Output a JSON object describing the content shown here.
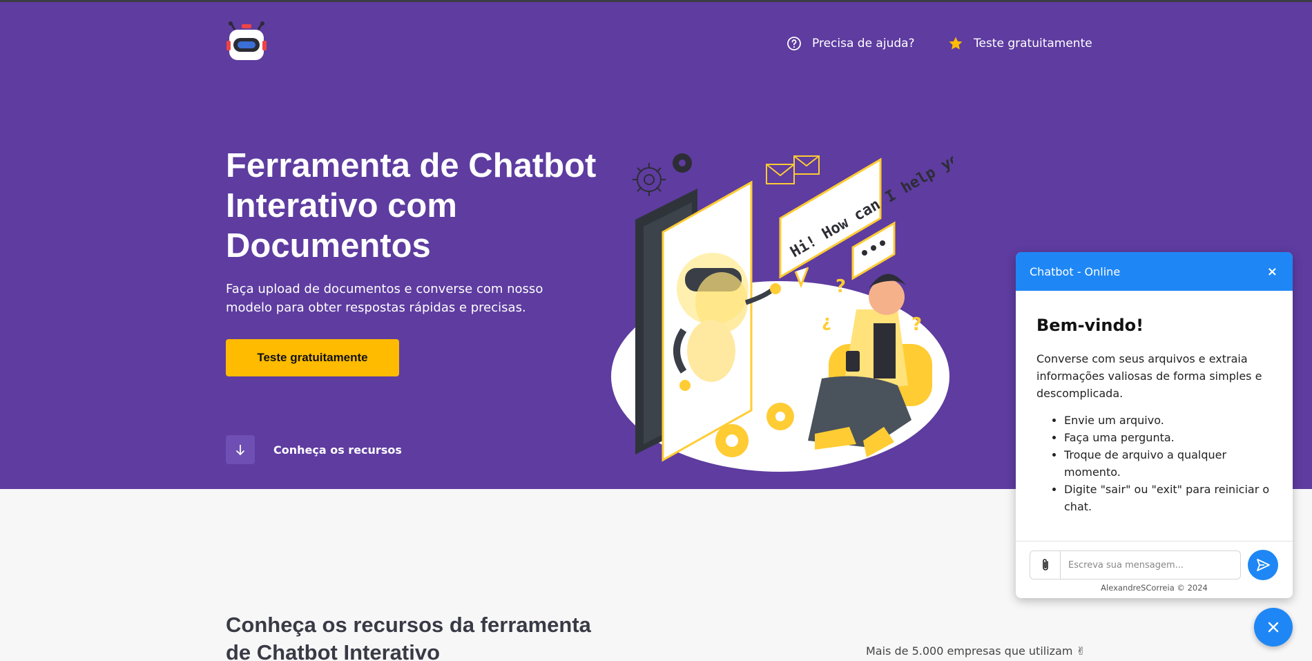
{
  "colors": {
    "hero_bg": "#5e3ca0",
    "accent_yellow": "#ffbb00",
    "chat_blue": "#1e87f5"
  },
  "header": {
    "logo_icon": "robot-head-icon",
    "nav": [
      {
        "label": "Precisa de ajuda?",
        "icon": "help-circle-icon"
      },
      {
        "label": "Teste gratuitamente",
        "icon": "star-icon"
      }
    ]
  },
  "hero": {
    "title": "Ferramenta de Chatbot Interativo com Documentos",
    "subtitle": "Faça upload de documentos e converse com nosso modelo para obter respostas rápidas e precisas.",
    "cta_label": "Teste gratuitamente",
    "explore_label": "Conheça os recursos",
    "illustration_text": {
      "bubble": "Hi! How can I help you?"
    }
  },
  "features": {
    "title": "Conheça os recursos da ferramenta de Chatbot Interativo",
    "companies_text": "Mais de 5.000 empresas que utilizam ✌"
  },
  "chat": {
    "header_title": "Chatbot - Online",
    "close_symbol": "×",
    "welcome_title": "Bem-vindo!",
    "intro": "Converse com seus arquivos e extraia informações valiosas de forma simples e descomplicada.",
    "bullets": [
      "Envie um arquivo.",
      "Faça uma pergunta.",
      "Troque de arquivo a qualquer momento.",
      "Digite \"sair\" ou \"exit\" para reiniciar o chat."
    ],
    "input_placeholder": "Escreva sua mensagem...",
    "input_value": "",
    "copyright": "AlexandreSCorreia © 2024"
  }
}
